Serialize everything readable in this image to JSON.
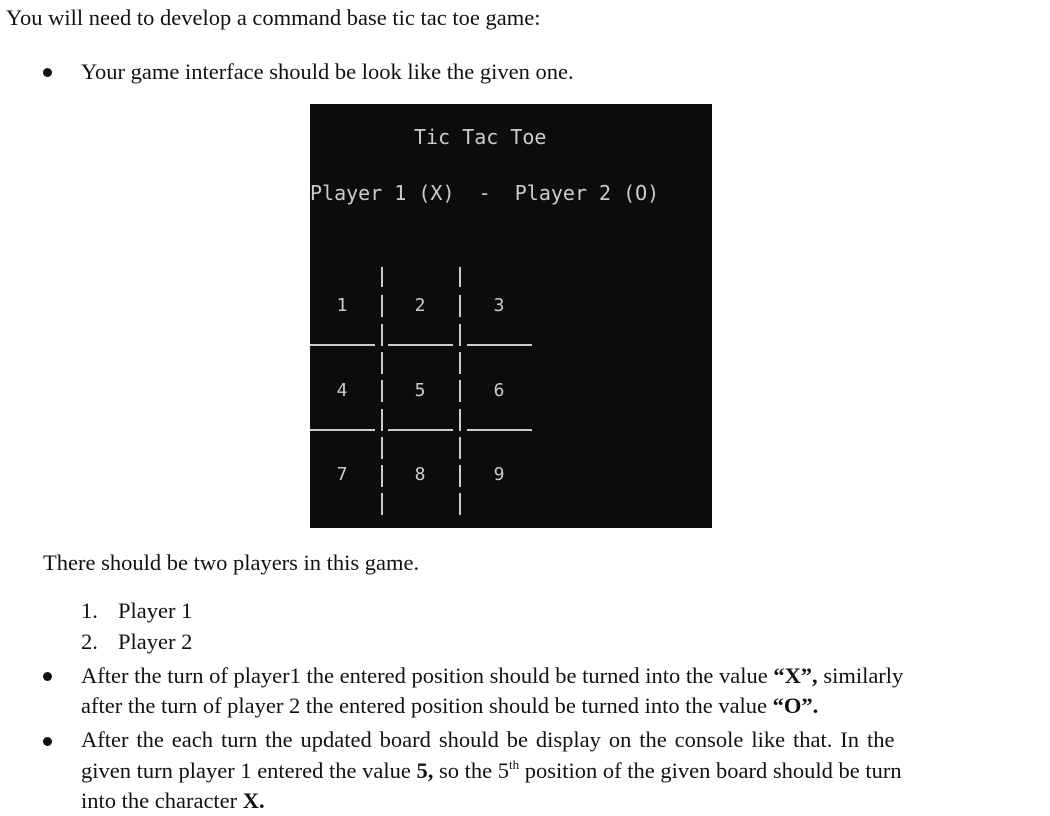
{
  "intro": "You will need to develop a command base tic tac toe game:",
  "bullet1": "Your game interface should be look like the given one.",
  "console": {
    "title": "Tic Tac Toe",
    "player1_label": "Player 1 (X)",
    "separator": "-",
    "player2_label": "Player 2 (O)",
    "board": [
      "1",
      "2",
      "3",
      "4",
      "5",
      "6",
      "7",
      "8",
      "9"
    ],
    "background_color": "#0c0c0c",
    "text_color": "#cccccc"
  },
  "players_intro": "There should be two players in this game.",
  "players_list": [
    {
      "num": "1.",
      "label": "Player 1"
    },
    {
      "num": "2.",
      "label": "Player 2"
    }
  ],
  "bullet2": {
    "line1_a": "After the turn of player1 the entered position should be turned into the value ",
    "line1_b": "“X”,",
    "line1_c": " similarly",
    "line2_a": "after the turn of player 2 the entered position should be turned into the value ",
    "line2_b": "“O”."
  },
  "bullet3": {
    "line1": "After the each turn the updated board should be display on the console like that. In the",
    "line2_a": "given turn player 1 entered the value ",
    "line2_b": "5,",
    "line2_c": " so the 5",
    "line2_sup": "th",
    "line2_d": " position of the given board should be turn",
    "line3_a": "into the character ",
    "line3_b": "X."
  }
}
